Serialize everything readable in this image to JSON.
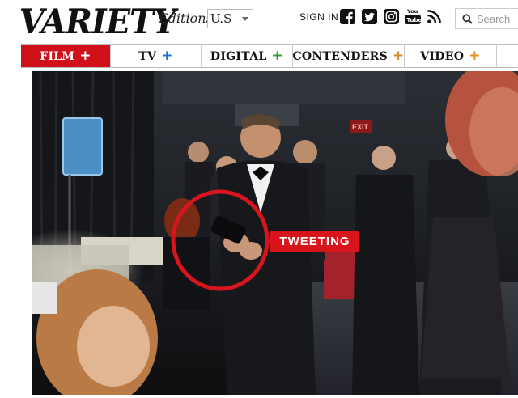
{
  "header": {
    "logo_text": "VARIETY",
    "editions_label": "Editions:",
    "edition_value": "U.S",
    "signin_label": "SIGN IN",
    "social_icons": [
      "facebook-icon",
      "twitter-icon",
      "instagram-icon",
      "youtube-icon",
      "rss-icon"
    ],
    "search_placeholder": "Search"
  },
  "nav": {
    "items": [
      {
        "label": "FILM",
        "plus_color": "#ffffff",
        "active": true
      },
      {
        "label": "TV",
        "plus_color": "#1f6fd1"
      },
      {
        "label": "DIGITAL",
        "plus_color": "#2e9e3a"
      },
      {
        "label": "CONTENDERS",
        "plus_color": "#d1892b"
      },
      {
        "label": "VIDEO",
        "plus_color": "#e88d1f"
      }
    ],
    "plus_symbol": "+"
  },
  "photo": {
    "annotation_label": "TWEETING",
    "exit_sign": "EXIT"
  },
  "colors": {
    "brand_red": "#d0111b",
    "annotation_red": "#d8141c"
  }
}
